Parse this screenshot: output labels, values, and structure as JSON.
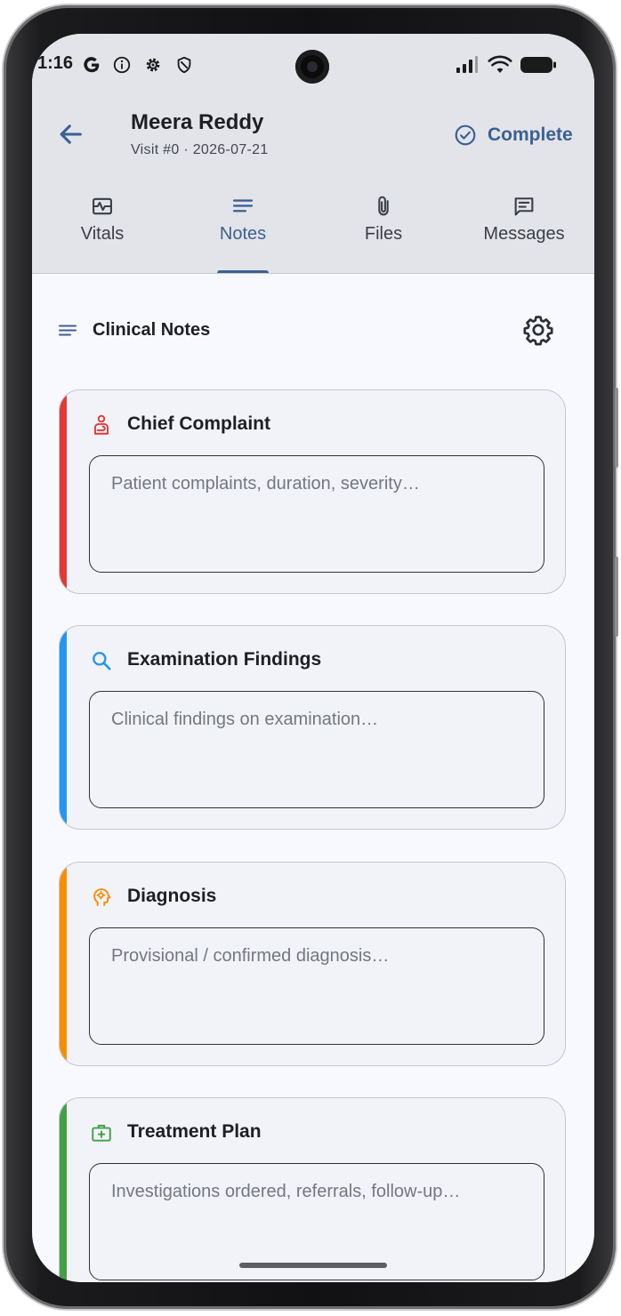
{
  "status_bar": {
    "time": "1:16",
    "icons": [
      "google-icon",
      "info-icon",
      "settings-icon",
      "shield-icon",
      "signal-icon",
      "wifi-icon",
      "battery-icon"
    ]
  },
  "header": {
    "title": "Meera Reddy",
    "subtitle": "Visit #0 · 2026-07-21",
    "action_label": "Complete",
    "action_color": "#3c6092"
  },
  "tabs": [
    {
      "label": "Vitals",
      "icon": "vitals-icon",
      "active": false
    },
    {
      "label": "Notes",
      "icon": "notes-icon",
      "active": true
    },
    {
      "label": "Files",
      "icon": "attachment-icon",
      "active": false
    },
    {
      "label": "Messages",
      "icon": "message-icon",
      "active": false
    }
  ],
  "section": {
    "title": "Clinical Notes",
    "icon": "notes-icon",
    "settings_icon": "gear-icon"
  },
  "cards": [
    {
      "title": "Chief Complaint",
      "placeholder": "Patient complaints, duration, severity…",
      "value": "",
      "accent": "#e53935",
      "icon": "patient-icon"
    },
    {
      "title": "Examination Findings",
      "placeholder": "Clinical findings on examination…",
      "value": "",
      "accent": "#2196f3",
      "icon": "search-icon"
    },
    {
      "title": "Diagnosis",
      "placeholder": "Provisional / confirmed diagnosis…",
      "value": "",
      "accent": "#fb8c00",
      "icon": "psychology-icon"
    },
    {
      "title": "Treatment Plan",
      "placeholder": "Investigations ordered, referrals, follow-up…",
      "value": "",
      "accent": "#43a047",
      "icon": "medical-kit-icon"
    }
  ]
}
